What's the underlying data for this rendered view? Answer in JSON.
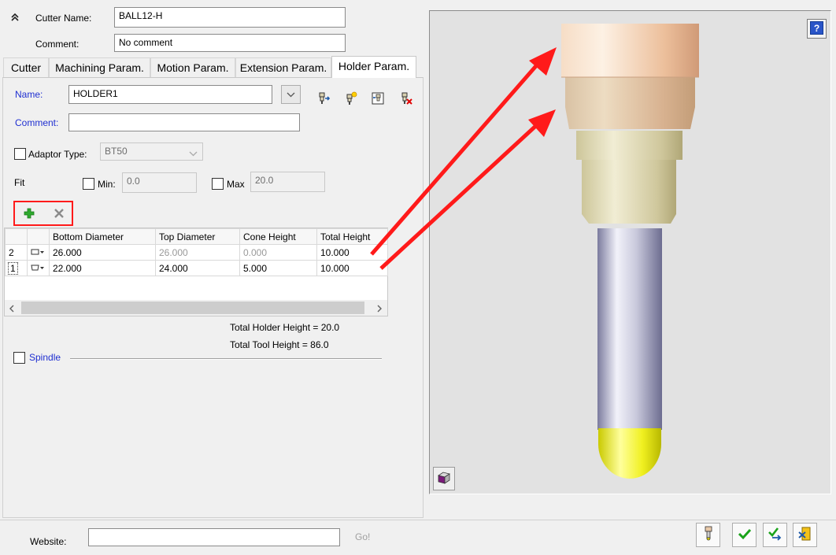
{
  "header": {
    "collapse_icon": "double-chevron-up-icon",
    "cutter_name_label": "Cutter Name:",
    "cutter_name_value": "BALL12-H",
    "comment_label": "Comment:",
    "comment_value": "No comment"
  },
  "tabs": [
    {
      "label": "Cutter"
    },
    {
      "label": "Machining Param."
    },
    {
      "label": "Motion Param."
    },
    {
      "label": "Extension Param."
    },
    {
      "label": "Holder Param.",
      "active": true
    }
  ],
  "holder": {
    "name_label": "Name:",
    "name_value": "HOLDER1",
    "comment_label": "Comment:",
    "comment_value": "",
    "adaptor_label": "Adaptor Type:",
    "adaptor_value": "BT50",
    "fit_label": "Fit",
    "min_label": "Min:",
    "min_value": "0.0",
    "max_label": "Max",
    "max_value": "20.0",
    "toolbar_icons": [
      "holder-load-icon",
      "holder-new-icon",
      "holder-save-icon",
      "holder-delete-icon"
    ]
  },
  "table": {
    "columns": [
      "",
      "",
      "Bottom Diameter",
      "Top Diameter",
      "Cone Height",
      "Total Height"
    ],
    "rows": [
      {
        "index": "2",
        "bottom": "26.000",
        "top": "26.000",
        "cone": "0.000",
        "total": "10.000",
        "top_disabled": true,
        "cone_disabled": true
      },
      {
        "index": "1",
        "bottom": "22.000",
        "top": "24.000",
        "cone": "5.000",
        "total": "10.000",
        "top_disabled": false,
        "cone_disabled": false
      }
    ]
  },
  "totals": {
    "holder_height": "Total Holder Height = 20.0",
    "tool_height": "Total Tool Height = 86.0"
  },
  "spindle_label": "Spindle",
  "footer": {
    "website_label": "Website:",
    "website_value": "",
    "go_label": "Go!"
  },
  "colors": {
    "annotation_red": "#ff1a1a",
    "label_blue": "#1f2fd1",
    "holder_upper": "#e9b99a",
    "holder_lower": "#d7d2a8",
    "shank": "#c9c9dc",
    "ball_tip": "#e8e817"
  }
}
